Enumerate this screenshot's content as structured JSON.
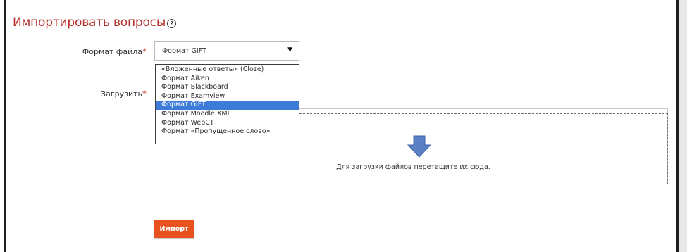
{
  "section": {
    "title": "Импортировать вопросы",
    "help_icon": "question-circle-icon"
  },
  "form": {
    "file_format_label": "Формат файла",
    "upload_label": "Загрузить",
    "required_marker": "*",
    "selected_format": "Формат GIFT",
    "format_options": [
      "«Вложенные ответы» (Cloze)",
      "Формат Aiken",
      "Формат Blackboard",
      "Формат Examview",
      "Формат GIFT",
      "Формат Moodle XML",
      "Формат WebCT",
      "Формат «Пропущенное слово»"
    ],
    "selected_index": 4
  },
  "dropzone": {
    "text": "Для загрузки файлов перетащите их сюда.",
    "icon": "arrow-down-icon"
  },
  "actions": {
    "import_label": "Импорт"
  },
  "colors": {
    "title": "#b4302a",
    "required": "#c0392b",
    "selected_option_bg": "#3d7bd8",
    "import_button": "#e8521e",
    "arrow": "#5a7fc4"
  }
}
